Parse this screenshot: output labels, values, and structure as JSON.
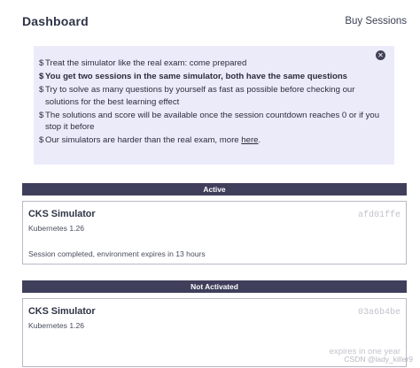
{
  "header": {
    "title": "Dashboard",
    "buy_sessions_label": "Buy Sessions"
  },
  "notice": {
    "close_icon": "close-icon",
    "bullet": "$",
    "items": [
      {
        "text": "Treat the simulator like the real exam: come prepared",
        "bold": false
      },
      {
        "text": "You get two sessions in the same simulator, both have the same questions",
        "bold": true
      },
      {
        "text": "Try to solve as many questions by yourself as fast as possible before checking our solutions for the best learning effect",
        "bold": false
      },
      {
        "text": "The solutions and score will be available once the session countdown reaches 0 or if you stop it before",
        "bold": false
      },
      {
        "text_before_link": "Our simulators are harder than the real exam, more ",
        "link_text": "here",
        "text_after_link": ".",
        "bold": false
      }
    ]
  },
  "sections": {
    "active_label": "Active",
    "not_activated_label": "Not Activated"
  },
  "cards": {
    "active": {
      "title": "CKS Simulator",
      "subtitle": "Kubernetes 1.26",
      "id": "afd01ffe",
      "status": "Session completed, environment expires in 13 hours"
    },
    "inactive": {
      "title": "CKS Simulator",
      "subtitle": "Kubernetes 1.26",
      "id": "03a6b4be",
      "expiry": "expires in one year"
    }
  },
  "watermark": "CSDN @lady_killer9",
  "colors": {
    "section_bar": "#3f3f5c",
    "notice_bg": "#ecebfa",
    "muted_text": "#c3c3cc"
  }
}
